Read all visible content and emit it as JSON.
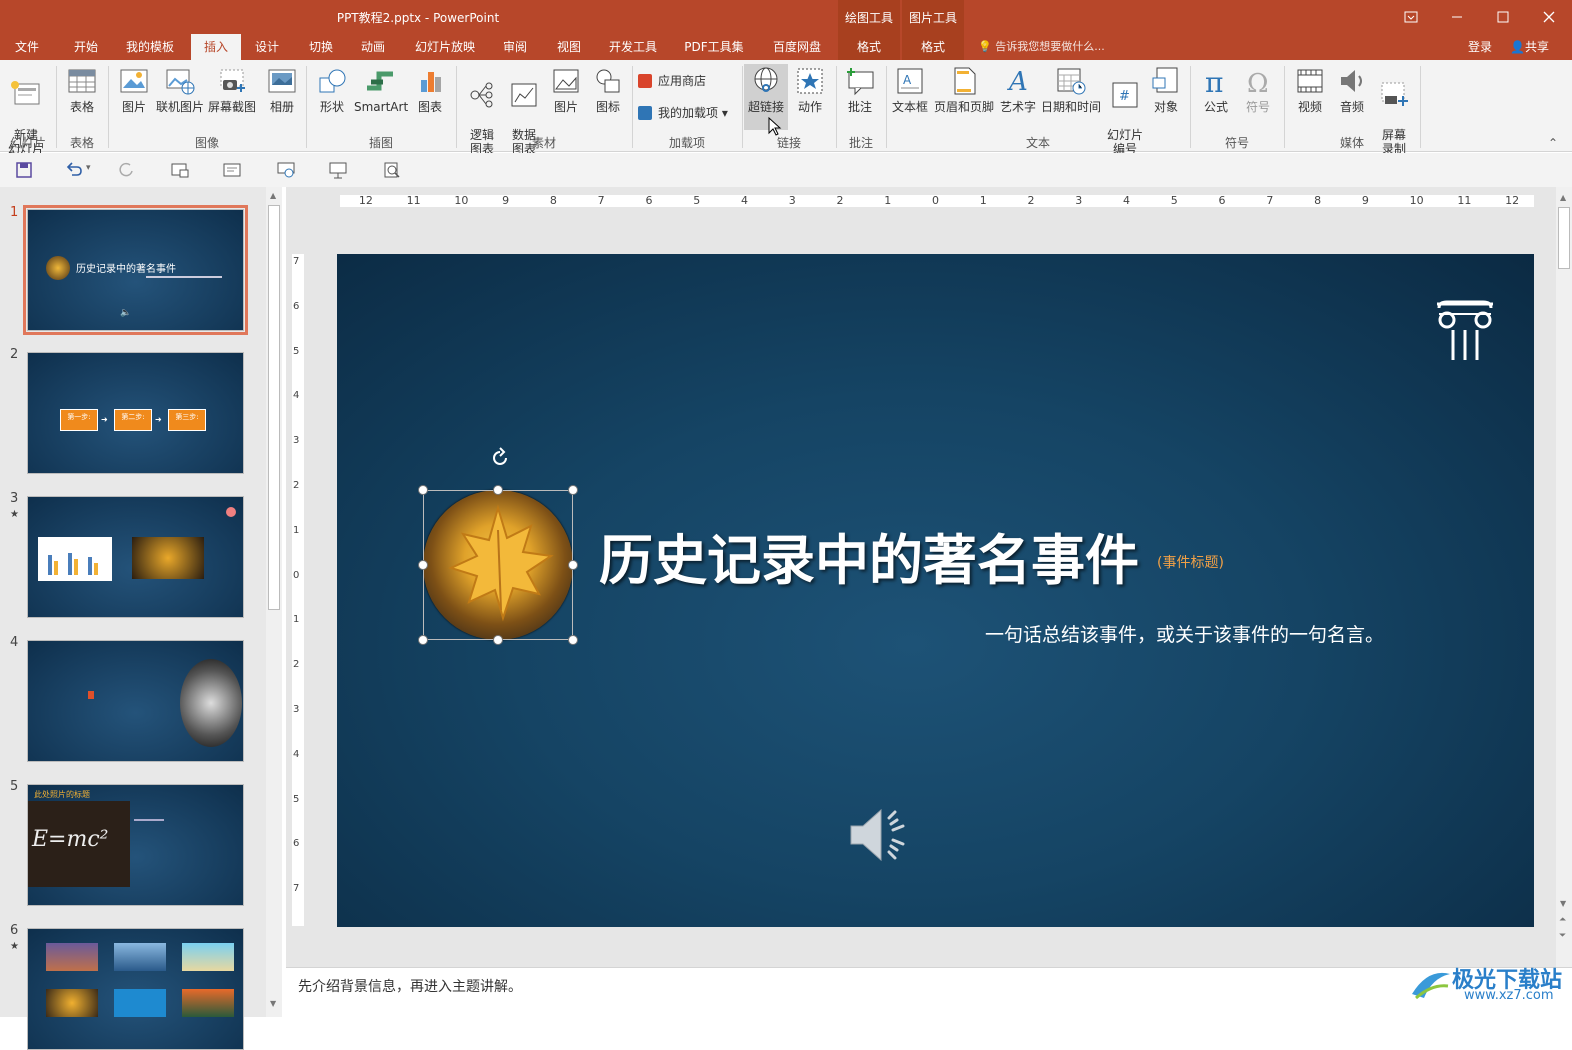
{
  "window": {
    "title": "PPT教程2.pptx - PowerPoint",
    "context_groups": [
      "绘图工具",
      "图片工具"
    ]
  },
  "tabs": [
    "文件",
    "开始",
    "我的模板",
    "插入",
    "设计",
    "切换",
    "动画",
    "幻灯片放映",
    "审阅",
    "视图",
    "开发工具",
    "PDF工具集",
    "百度网盘",
    "格式",
    "格式"
  ],
  "active_tab": "插入",
  "tellme": "告诉我您想要做什么...",
  "login": "登录",
  "share": "共享",
  "ribbon": {
    "new_slide": "新建\n幻灯片",
    "table": "表格",
    "picture": "图片",
    "online_picture": "联机图片",
    "screenshot": "屏幕截图",
    "album": "相册",
    "shapes": "形状",
    "smartart": "SmartArt",
    "chart": "图表",
    "logic_chart": "逻辑\n图表",
    "data_chart": "数据\n图表",
    "material_picture": "图片",
    "icon": "图标",
    "store": "应用商店",
    "my_addins": "我的加载项",
    "hyperlink": "超链接",
    "action": "动作",
    "comment": "批注",
    "textbox": "文本框",
    "header_footer": "页眉和页脚",
    "wordart": "艺术字",
    "datetime": "日期和时间",
    "slide_number": "幻灯片\n编号",
    "object": "对象",
    "equation": "公式",
    "symbol": "符号",
    "video": "视频",
    "audio": "音频",
    "screen_record": "屏幕\n录制",
    "groups": {
      "slides": "幻灯片",
      "tables": "表格",
      "images": "图像",
      "illustrations": "插图",
      "material": "素材",
      "addins": "加载项",
      "links": "链接",
      "comments": "批注",
      "text": "文本",
      "symbols": "符号",
      "media": "媒体"
    }
  },
  "ruler_numbers": [
    "12",
    "11",
    "10",
    "9",
    "8",
    "7",
    "6",
    "5",
    "4",
    "3",
    "2",
    "1",
    "0",
    "1",
    "2",
    "3",
    "4",
    "5",
    "6",
    "7",
    "8",
    "9",
    "10",
    "11",
    "12"
  ],
  "thumbnails": [
    {
      "num": "1",
      "star": "",
      "title": "历史记录中的著名事件"
    },
    {
      "num": "2",
      "star": "",
      "steps": [
        "第一步:",
        "第二步:",
        "第三步:"
      ]
    },
    {
      "num": "3",
      "star": "★"
    },
    {
      "num": "4",
      "star": ""
    },
    {
      "num": "5",
      "star": "",
      "title": "此处照片的标题",
      "formula": "E=mc²"
    },
    {
      "num": "6",
      "star": "★"
    }
  ],
  "slide": {
    "title": "历史记录中的著名事件",
    "tag": "(事件标题)",
    "subtitle": "一句话总结该事件，或关于该事件的一句名言。"
  },
  "notes": "先介绍背景信息，再进入主题讲解。",
  "watermark": {
    "name": "极光下载站",
    "url": "www.xz7.com"
  },
  "colors": {
    "accent": "#b7472a",
    "slide_bg": "#154464",
    "tag": "#f0a046"
  }
}
